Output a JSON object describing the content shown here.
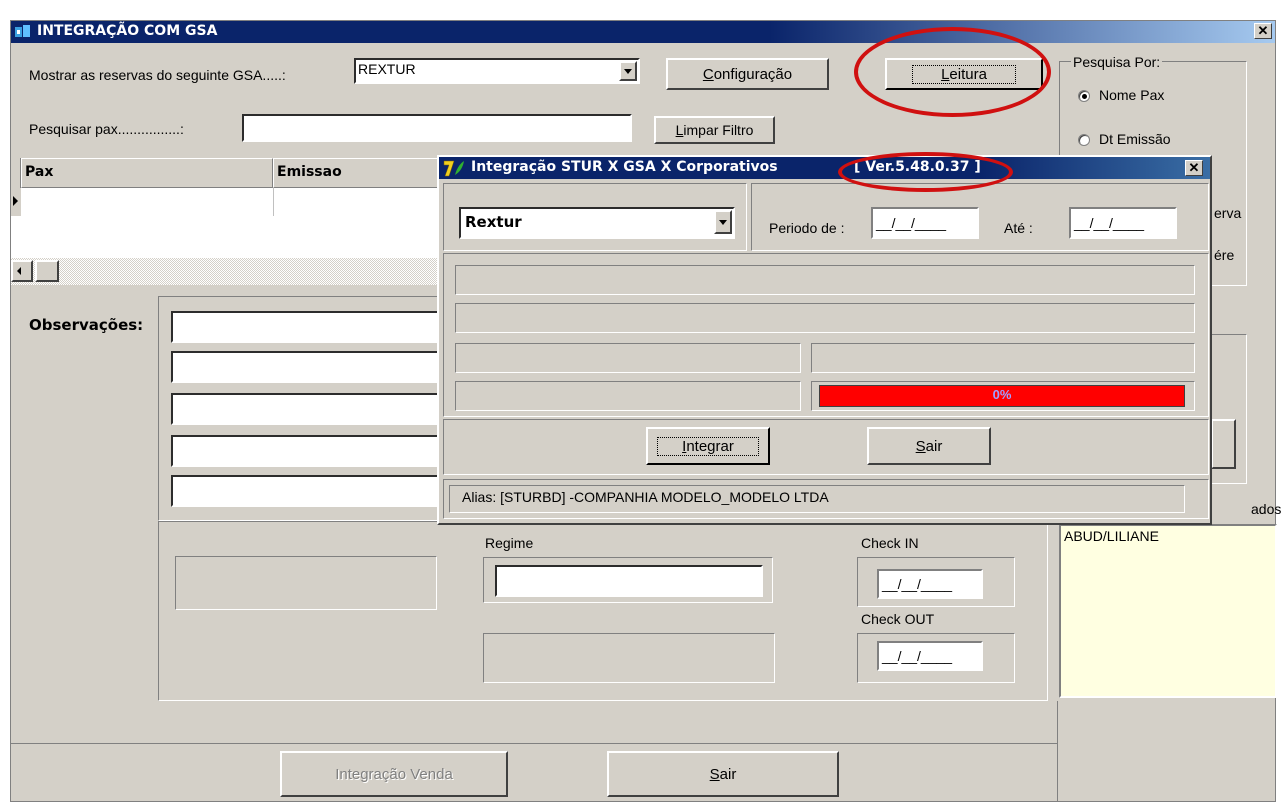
{
  "main_window": {
    "title": "INTEGRAÇÃO COM GSA",
    "close_glyph": "✕",
    "gsa_label": "Mostrar as reservas do seguinte GSA.....:",
    "gsa_selected": "REXTUR",
    "config_button": "Configuração",
    "leitura_button": "Leitura",
    "search_label": "Pesquisar pax................:",
    "search_value": "",
    "clear_filter_button": "Limpar Filtro",
    "grid_columns": [
      "Pax",
      "Emissao"
    ],
    "search_by": {
      "label": "Pesquisa Por:",
      "options": [
        {
          "label": "Nome Pax",
          "selected": true
        },
        {
          "label": "Dt Emissão",
          "selected": false
        }
      ],
      "partial_reserva": "erva",
      "partial_pere": "ére"
    },
    "observations_label": "Observações:",
    "regime_label": "Regime",
    "checkin_label": "Check IN",
    "checkin_value": "__/__/____",
    "checkout_label": "Check OUT",
    "checkout_value": "__/__/____",
    "partial_ados": "ados",
    "names_list": [
      "ABUD/LILIANE"
    ],
    "integracao_venda_button": "Integração Venda",
    "sair_button": "Sair"
  },
  "dialog": {
    "title": "Integração STUR X GSA X Corporativos",
    "version": "[ Ver.5.48.0.37 ]",
    "close_glyph": "✕",
    "gsa_selected": "Rextur",
    "periodo_label": "Periodo de :",
    "periodo_value": "__/__/____",
    "ate_label": "Até :",
    "ate_value": "__/__/____",
    "progress_percent": 0,
    "progress_text": "0%",
    "integrar_button": "Integrar",
    "sair_button": "Sair",
    "alias_text": "Alias: [STURBD] -COMPANHIA MODELO_MODELO LTDA"
  },
  "colors": {
    "titlebar": "#0a246a",
    "progress_fill": "#ff0000",
    "annotation_ring": "#d01010",
    "names_list_bg": "#ffffe1"
  }
}
